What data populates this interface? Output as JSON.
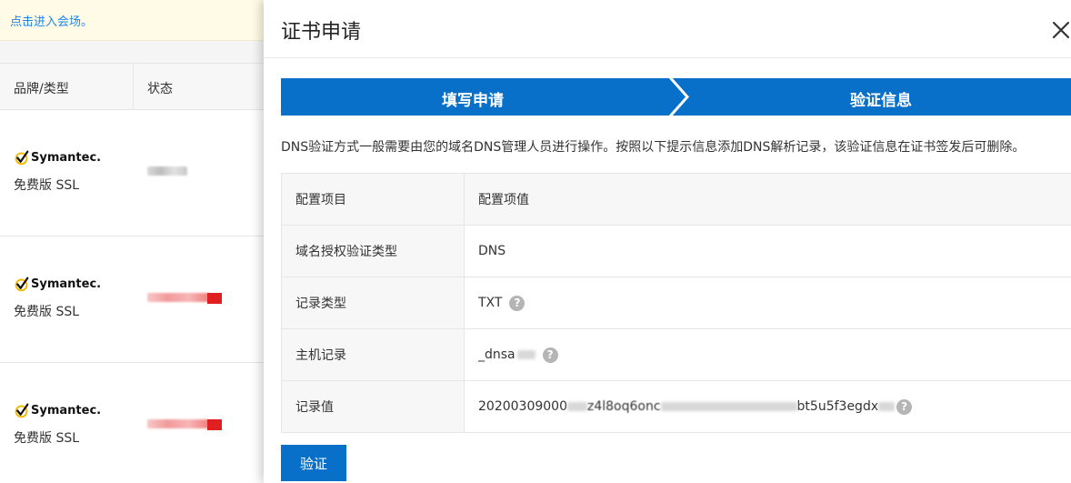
{
  "background": {
    "notice_link": "点击进入会场。",
    "table_headers": {
      "brand": "品牌/类型",
      "status": "状态"
    },
    "rows": [
      {
        "brand": "Symantec.",
        "type": "免费版 SSL"
      },
      {
        "brand": "Symantec.",
        "type": "免费版 SSL"
      },
      {
        "brand": "Symantec.",
        "type": "免费版 SSL"
      }
    ]
  },
  "drawer": {
    "title": "证书申请",
    "close_icon": "close-icon",
    "steps": [
      "填写申请",
      "验证信息"
    ],
    "description": "DNS验证方式一般需要由您的域名DNS管理人员进行操作。按照以下提示信息添加DNS解析记录，该验证信息在证书签发后可删除。",
    "table": {
      "header": {
        "key": "配置项目",
        "value": "配置项值"
      },
      "rows": [
        {
          "key": "域名授权验证类型",
          "value": "DNS",
          "help": false
        },
        {
          "key": "记录类型",
          "value": "TXT",
          "help": true
        },
        {
          "key": "主机记录",
          "value": "_dnsa",
          "help": true
        },
        {
          "key": "记录值",
          "value_prefix": "20200309000",
          "value_mid1": "z4l8oq6onc",
          "value_mid2": "bt5u5f3egdx",
          "help": true
        }
      ]
    },
    "verify_button": "验证"
  },
  "colors": {
    "accent": "#0870c9",
    "link": "#1c86ee",
    "notice_bg": "#fffbe6"
  }
}
